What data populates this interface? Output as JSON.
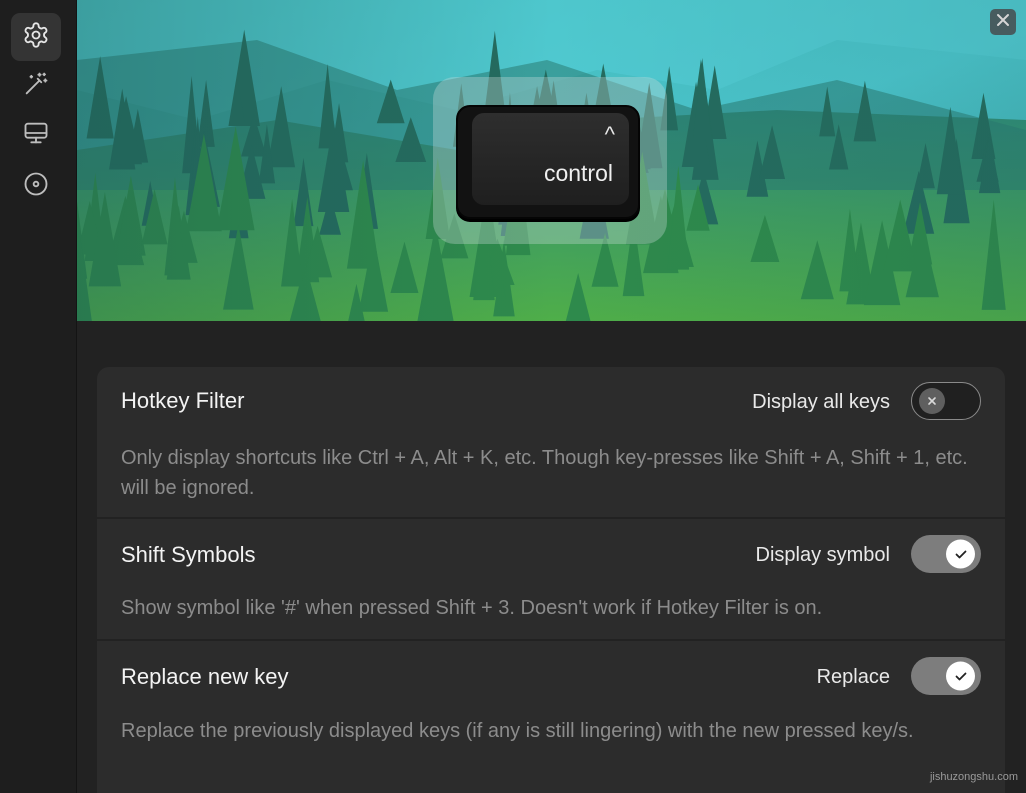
{
  "sidebar": {
    "items": [
      {
        "icon": "gear-icon",
        "active": true
      },
      {
        "icon": "magic-wand-icon",
        "active": false
      },
      {
        "icon": "monitor-icon",
        "active": false
      },
      {
        "icon": "disc-icon",
        "active": false
      }
    ]
  },
  "preview": {
    "key_symbol": "^",
    "key_label": "control",
    "close_icon": "close-icon"
  },
  "settings": [
    {
      "title": "Hotkey Filter",
      "toggle_label": "Display all keys",
      "toggle_on": false,
      "description": "Only display shortcuts like Ctrl + A, Alt + K, etc. Though key-presses like Shift + A, Shift + 1, etc. will be ignored."
    },
    {
      "title": "Shift Symbols",
      "toggle_label": "Display symbol",
      "toggle_on": true,
      "description": "Show symbol like '#' when pressed Shift + 3. Doesn't work if Hotkey Filter is on."
    },
    {
      "title": "Replace new key",
      "toggle_label": "Replace",
      "toggle_on": true,
      "description": "Replace the previously displayed keys (if any is still lingering) with the new pressed key/s."
    }
  ],
  "watermark": "jishuzongshu.com",
  "colors": {
    "sidebar_bg": "#1e1e1e",
    "panel_bg": "#222222",
    "card_bg": "#2c2c2c",
    "toggle_on_bg": "#7d7d7d"
  }
}
